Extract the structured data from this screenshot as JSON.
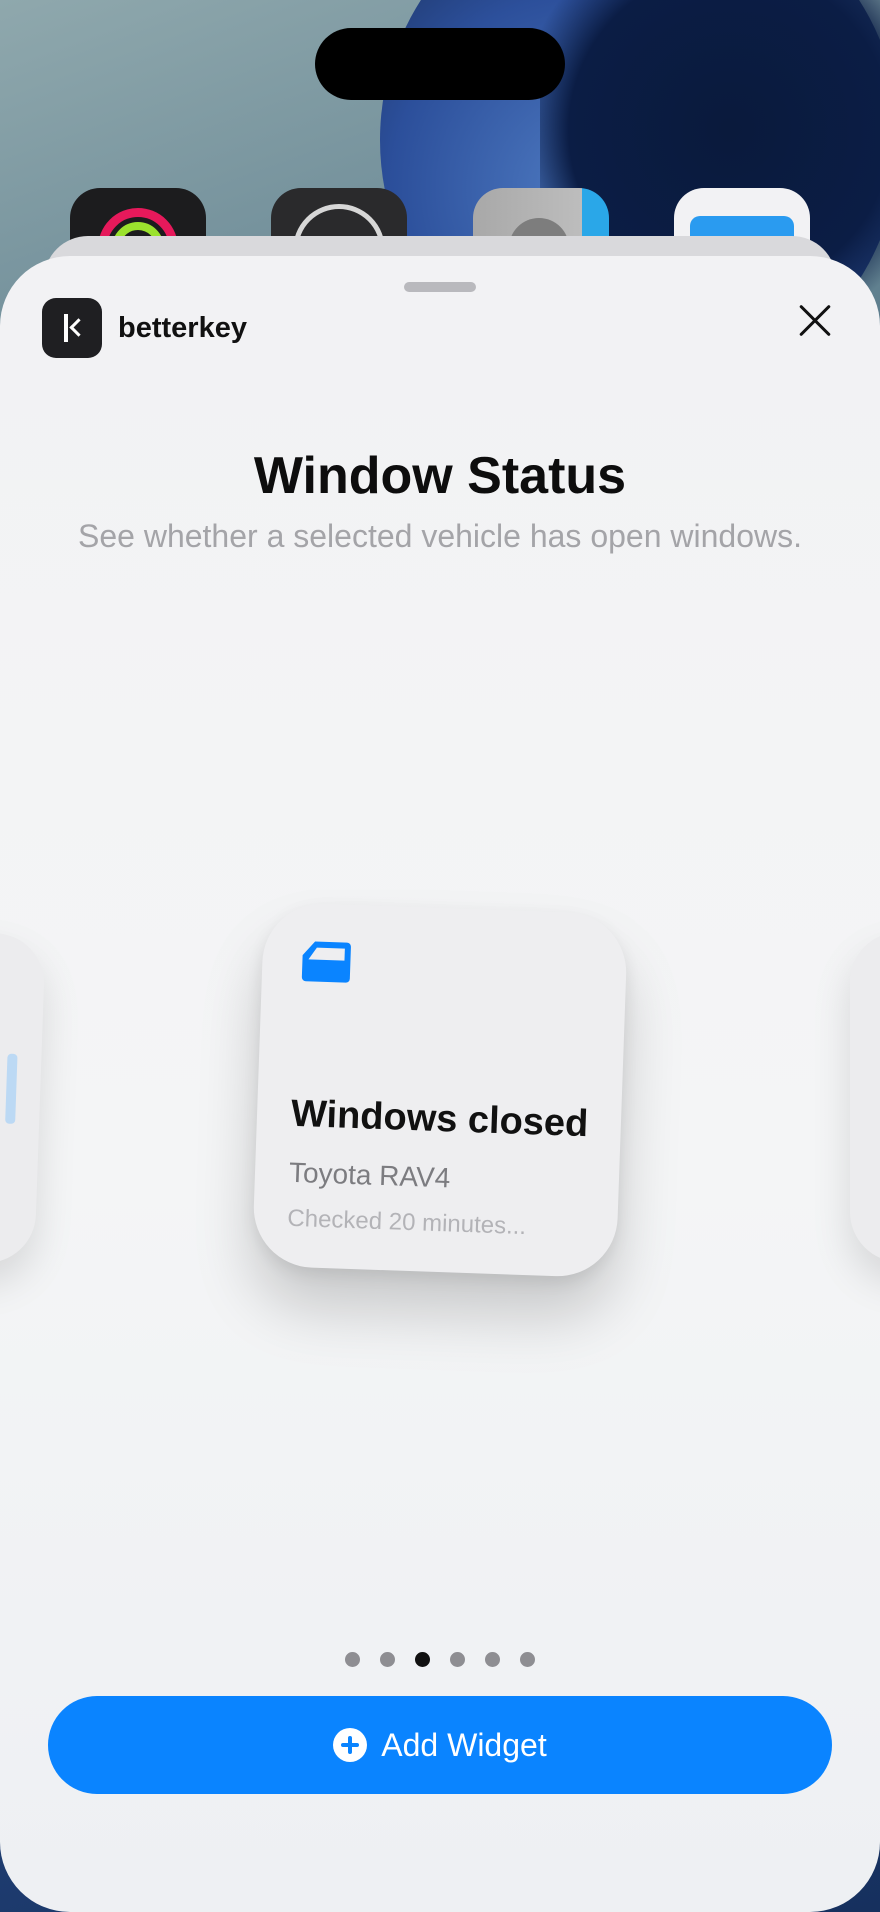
{
  "app": {
    "name": "betterkey"
  },
  "widget_gallery": {
    "title": "Window Status",
    "description": "See whether a selected vehicle has open windows.",
    "page_count": 6,
    "active_page": 3
  },
  "widget": {
    "icon": "car-door-icon",
    "headline": "Windows closed",
    "vehicle": "Toyota RAV4",
    "checked": "Checked 20 minutes..."
  },
  "actions": {
    "add_widget": "Add Widget"
  },
  "colors": {
    "accent": "#0a84ff"
  }
}
